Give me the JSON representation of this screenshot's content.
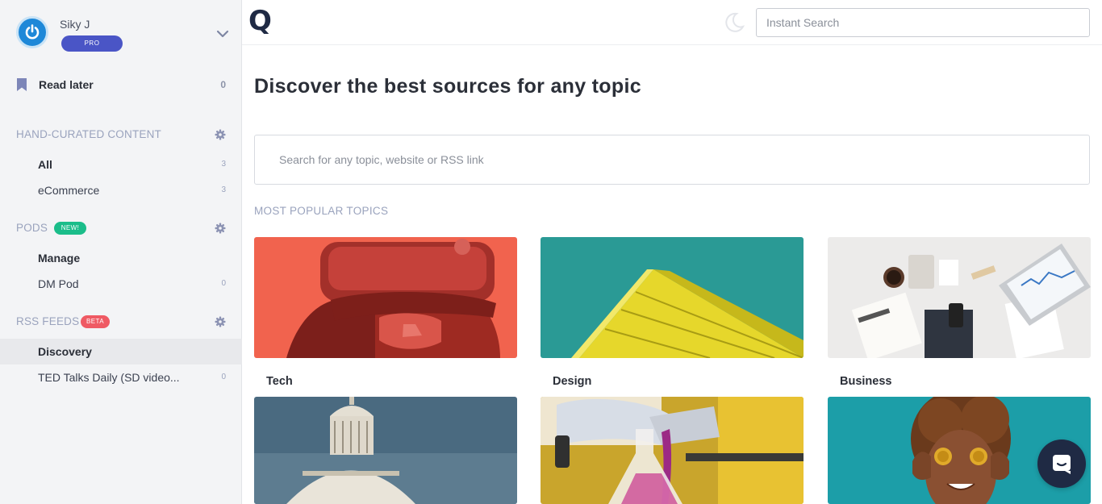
{
  "user": {
    "name": "Siky J",
    "plan_badge": "PRO"
  },
  "read_later": {
    "label": "Read later",
    "count": "0"
  },
  "sections": {
    "hand_curated": {
      "title": "HAND-CURATED CONTENT",
      "items": [
        {
          "label": "All",
          "count": "3"
        },
        {
          "label": "eCommerce",
          "count": "3"
        }
      ]
    },
    "pods": {
      "title": "PODS",
      "tag": "NEW!",
      "items": [
        {
          "label": "Manage",
          "count": ""
        },
        {
          "label": "DM Pod",
          "count": "0"
        }
      ]
    },
    "rss_feeds": {
      "title": "RSS FEEDS",
      "tag": "BETA",
      "items": [
        {
          "label": "Discovery",
          "count": ""
        },
        {
          "label": "TED Talks Daily (SD video...",
          "count": "0"
        }
      ]
    }
  },
  "topbar": {
    "logo": "Q",
    "search_placeholder": "Instant Search"
  },
  "main": {
    "headline": "Discover the best sources for any topic",
    "topic_search_placeholder": "Search for any topic, website or RSS link",
    "popular_label": "MOST POPULAR TOPICS",
    "topics": [
      {
        "label": "Tech"
      },
      {
        "label": "Design"
      },
      {
        "label": "Business"
      },
      {
        "label": ""
      },
      {
        "label": ""
      },
      {
        "label": ""
      }
    ]
  },
  "colors": {
    "accent": "#4a55c6",
    "new_tag": "#1bbd8a",
    "beta_tag": "#ef5a64",
    "sidebar_bg": "#f3f4f6",
    "chat_button": "#1f2a44"
  },
  "icons": {
    "avatar": "power-icon",
    "dropdown": "chevron-down-icon",
    "read_later": "bookmark-icon",
    "section_settings": "gear-icon",
    "theme": "moon-icon",
    "chat": "chat-icon"
  }
}
